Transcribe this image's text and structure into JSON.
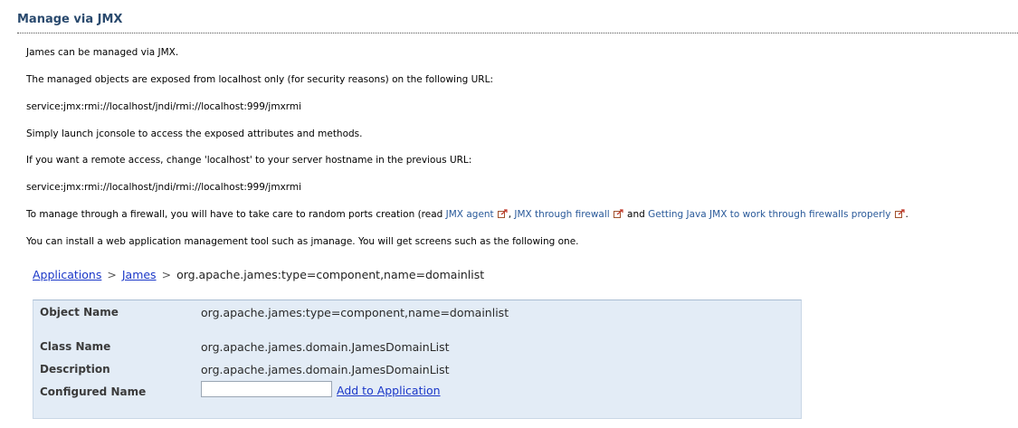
{
  "section": {
    "title": "Manage via JMX"
  },
  "paragraphs": {
    "p1": "James can be managed via JMX.",
    "p2": "The managed objects are exposed from localhost only (for security reasons) on the following URL:",
    "p3": "service:jmx:rmi://localhost/jndi/rmi://localhost:999/jmxrmi",
    "p4": "Simply launch jconsole to access the exposed attributes and methods.",
    "p5": "If you want a remote access, change 'localhost' to your server hostname in the previous URL:",
    "p6": "service:jmx:rmi://localhost/jndi/rmi://localhost:999/jmxrmi",
    "p7_prefix": "To manage through a firewall, you will have to take care to random ports creation (read ",
    "p7_link1": "JMX agent",
    "p7_sep1": ", ",
    "p7_link2": "JMX through firewall",
    "p7_sep2": " and ",
    "p7_link3": "Getting Java JMX to work through firewalls properly",
    "p7_suffix": ".",
    "p8": "You can install a web application management tool such as jmanage. You will get screens such as the following one."
  },
  "breadcrumb": {
    "item1": "Applications",
    "item2": "James",
    "current": "org.apache.james:type=component,name=domainlist",
    "separator": ">"
  },
  "panel": {
    "object_name_label": "Object Name",
    "object_name_value": "org.apache.james:type=component,name=domainlist",
    "class_name_label": "Class Name",
    "class_name_value": "org.apache.james.domain.JamesDomainList",
    "description_label": "Description",
    "description_value": "org.apache.james.domain.JamesDomainList",
    "configured_name_label": "Configured Name",
    "configured_name_value": "",
    "add_link": "Add to Application"
  },
  "colors": {
    "title": "#2a4a6e",
    "link": "#2a5a9a",
    "panel_bg": "#e3ecf6",
    "breadcrumb_link": "#1a37c8"
  },
  "icons": {
    "external_link": "external-link-icon"
  }
}
